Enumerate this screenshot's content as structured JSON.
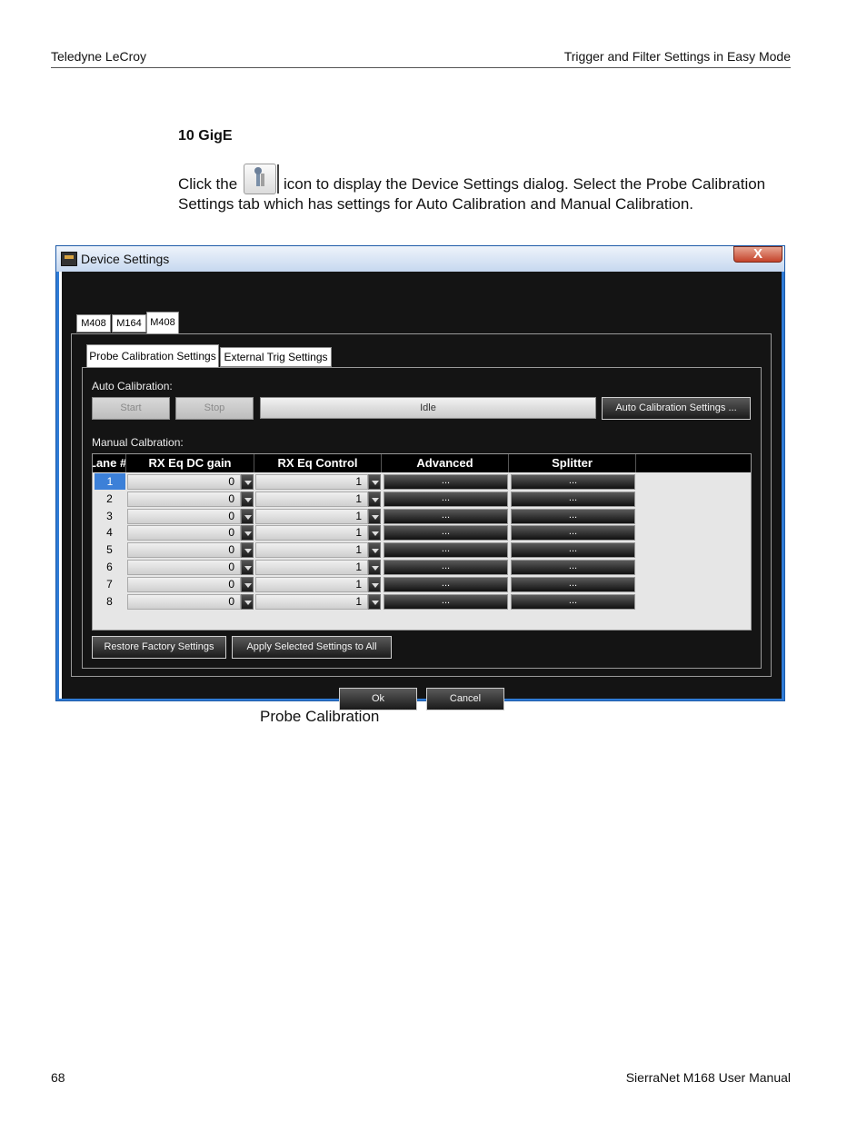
{
  "header": {
    "left": "Teledyne LeCroy",
    "right": "Trigger and Filter Settings in Easy Mode"
  },
  "section_title": "10 GigE",
  "para_before_icon": "Click the",
  "para_after_icon_line1": "icon to display the Device Settings dialog. Select the Probe Calibration",
  "para_line2": "Settings tab which has settings for Auto Calibration and Manual Calibration.",
  "inline_icon": "device-settings-icon",
  "dialog": {
    "title": "Device Settings",
    "close_label": "X",
    "device_tabs": [
      "M408",
      "M164",
      "M408"
    ],
    "settings_tabs": [
      "Probe Calibration Settings",
      "External Trig Settings"
    ],
    "auto_calibration_label": "Auto Calibration:",
    "start_label": "Start",
    "stop_label": "Stop",
    "status": "Idle",
    "auto_settings_label": "Auto Calibration Settings ...",
    "manual_calibration_label": "Manual Calbration:",
    "columns": [
      "Lane #",
      "RX Eq DC gain",
      "RX Eq Control",
      "Advanced",
      "Splitter"
    ],
    "rows": [
      {
        "lane": "1",
        "dc_gain": "0",
        "control": "1",
        "advanced": "...",
        "splitter": "..."
      },
      {
        "lane": "2",
        "dc_gain": "0",
        "control": "1",
        "advanced": "...",
        "splitter": "..."
      },
      {
        "lane": "3",
        "dc_gain": "0",
        "control": "1",
        "advanced": "...",
        "splitter": "..."
      },
      {
        "lane": "4",
        "dc_gain": "0",
        "control": "1",
        "advanced": "...",
        "splitter": "..."
      },
      {
        "lane": "5",
        "dc_gain": "0",
        "control": "1",
        "advanced": "...",
        "splitter": "..."
      },
      {
        "lane": "6",
        "dc_gain": "0",
        "control": "1",
        "advanced": "...",
        "splitter": "..."
      },
      {
        "lane": "7",
        "dc_gain": "0",
        "control": "1",
        "advanced": "...",
        "splitter": "..."
      },
      {
        "lane": "8",
        "dc_gain": "0",
        "control": "1",
        "advanced": "...",
        "splitter": "..."
      }
    ],
    "restore_label": "Restore Factory Settings",
    "apply_all_label": "Apply Selected Settings to All",
    "ok_label": "Ok",
    "cancel_label": "Cancel"
  },
  "caption": "Probe Calibration",
  "footer": {
    "left": "68",
    "right": "SierraNet M168 User Manual"
  }
}
